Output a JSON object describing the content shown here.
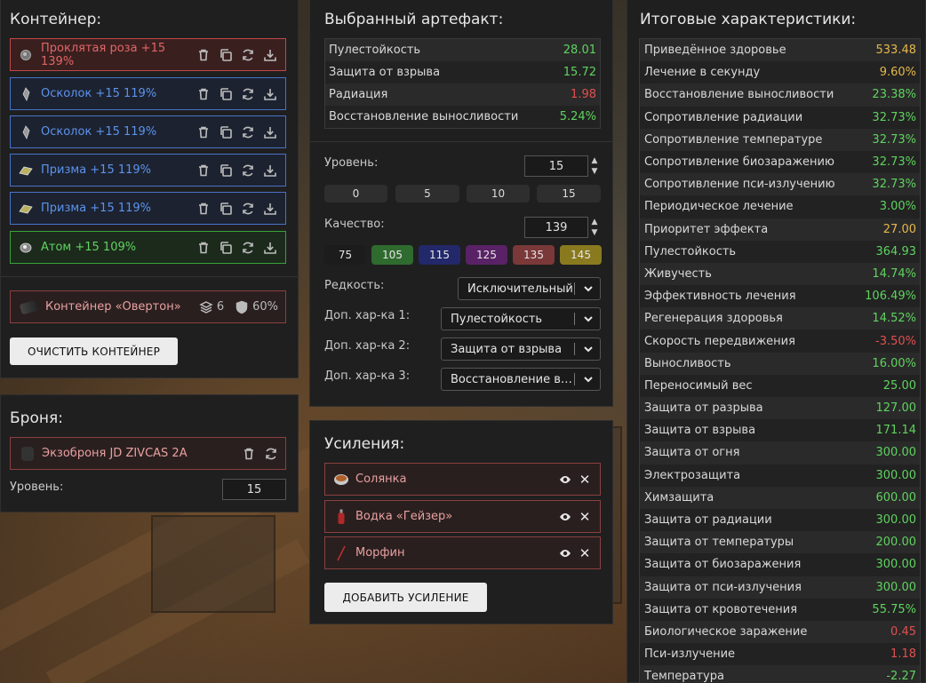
{
  "container": {
    "title": "Контейнер:",
    "items": [
      {
        "label": "Проклятая роза +15 139%",
        "icon": "rose-artifact-icon"
      },
      {
        "label": "Осколок +15 119%",
        "icon": "shard-artifact-icon"
      },
      {
        "label": "Осколок +15 119%",
        "icon": "shard-artifact-icon"
      },
      {
        "label": "Призма +15 119%",
        "icon": "prism-artifact-icon"
      },
      {
        "label": "Призма +15 119%",
        "icon": "prism-artifact-icon"
      },
      {
        "label": "Атом +15 109%",
        "icon": "atom-artifact-icon"
      }
    ],
    "box": {
      "label": "Контейнер «Овертон»",
      "slots": "6",
      "protection": "60%"
    },
    "clear_button": "ОЧИСТИТЬ КОНТЕЙНЕР"
  },
  "armor": {
    "title": "Броня:",
    "item": "Экзоброня JD ZIVCAS 2A",
    "level_label": "Уровень:",
    "level_value": "15"
  },
  "artifact": {
    "title": "Выбранный артефакт:",
    "stats": [
      {
        "name": "Пулестойкость",
        "value": "28.01",
        "color": "g"
      },
      {
        "name": "Защита от взрыва",
        "value": "15.72",
        "color": "g"
      },
      {
        "name": "Радиация",
        "value": "1.98",
        "color": "r"
      },
      {
        "name": "Восстановление выносливости",
        "value": "5.24%",
        "color": "g"
      }
    ],
    "level_label": "Уровень:",
    "level_value": "15",
    "level_presets": [
      "0",
      "5",
      "10",
      "15"
    ],
    "quality_label": "Качество:",
    "quality_value": "139",
    "quality_presets": [
      {
        "label": "75",
        "color": "#1c1c1c"
      },
      {
        "label": "105",
        "color": "#2f6b2f"
      },
      {
        "label": "115",
        "color": "#22286a"
      },
      {
        "label": "125",
        "color": "#5a2266"
      },
      {
        "label": "135",
        "color": "#7a3838"
      },
      {
        "label": "145",
        "color": "#8a7a1f"
      }
    ],
    "rarity_label": "Редкость:",
    "rarity_value": "Исключительный",
    "extra1_label": "Доп. хар-ка 1:",
    "extra1_value": "Пулестойкость",
    "extra2_label": "Доп. хар-ка 2:",
    "extra2_value": "Защита от взрыва",
    "extra3_label": "Доп. хар-ка 3:",
    "extra3_value": "Восстановление выносливости"
  },
  "boosts": {
    "title": "Усиления:",
    "items": [
      {
        "label": "Солянка",
        "icon": "soup-icon"
      },
      {
        "label": "Водка «Гейзер»",
        "icon": "bottle-icon"
      },
      {
        "label": "Морфин",
        "icon": "syringe-icon"
      }
    ],
    "add_button": "ДОБАВИТЬ УСИЛЕНИЕ"
  },
  "totals": {
    "title": "Итоговые характеристики:",
    "rows": [
      {
        "name": "Приведённое здоровье",
        "value": "533.48",
        "color": "y"
      },
      {
        "name": "Лечение в секунду",
        "value": "9.60%",
        "color": "y"
      },
      {
        "name": "Восстановление выносливости",
        "value": "23.38%",
        "color": "g"
      },
      {
        "name": "Сопротивление радиации",
        "value": "32.73%",
        "color": "g"
      },
      {
        "name": "Сопротивление температуре",
        "value": "32.73%",
        "color": "g"
      },
      {
        "name": "Сопротивление биозаражению",
        "value": "32.73%",
        "color": "g"
      },
      {
        "name": "Сопротивление пси-излучению",
        "value": "32.73%",
        "color": "g"
      },
      {
        "name": "Периодическое лечение",
        "value": "3.00%",
        "color": "g"
      },
      {
        "name": "Приоритет эффекта",
        "value": "27.00",
        "color": "y"
      },
      {
        "name": "Пулестойкость",
        "value": "364.93",
        "color": "g"
      },
      {
        "name": "Живучесть",
        "value": "14.74%",
        "color": "g"
      },
      {
        "name": "Эффективность лечения",
        "value": "106.49%",
        "color": "g"
      },
      {
        "name": "Регенерация здоровья",
        "value": "14.52%",
        "color": "g"
      },
      {
        "name": "Скорость передвижения",
        "value": "-3.50%",
        "color": "r"
      },
      {
        "name": "Выносливость",
        "value": "16.00%",
        "color": "g"
      },
      {
        "name": "Переносимый вес",
        "value": "25.00",
        "color": "g"
      },
      {
        "name": "Защита от разрыва",
        "value": "127.00",
        "color": "g"
      },
      {
        "name": "Защита от взрыва",
        "value": "171.14",
        "color": "g"
      },
      {
        "name": "Защита от огня",
        "value": "300.00",
        "color": "g"
      },
      {
        "name": "Электрозащита",
        "value": "300.00",
        "color": "g"
      },
      {
        "name": "Химзащита",
        "value": "600.00",
        "color": "g"
      },
      {
        "name": "Защита от радиации",
        "value": "300.00",
        "color": "g"
      },
      {
        "name": "Защита от температуры",
        "value": "200.00",
        "color": "g"
      },
      {
        "name": "Защита от биозаражения",
        "value": "300.00",
        "color": "g"
      },
      {
        "name": "Защита от пси-излучения",
        "value": "300.00",
        "color": "g"
      },
      {
        "name": "Защита от кровотечения",
        "value": "55.75%",
        "color": "g"
      },
      {
        "name": "Биологическое заражение",
        "value": "0.45",
        "color": "r"
      },
      {
        "name": "Пси-излучение",
        "value": "1.18",
        "color": "r"
      },
      {
        "name": "Температура",
        "value": "-2.27",
        "color": "g"
      }
    ]
  }
}
